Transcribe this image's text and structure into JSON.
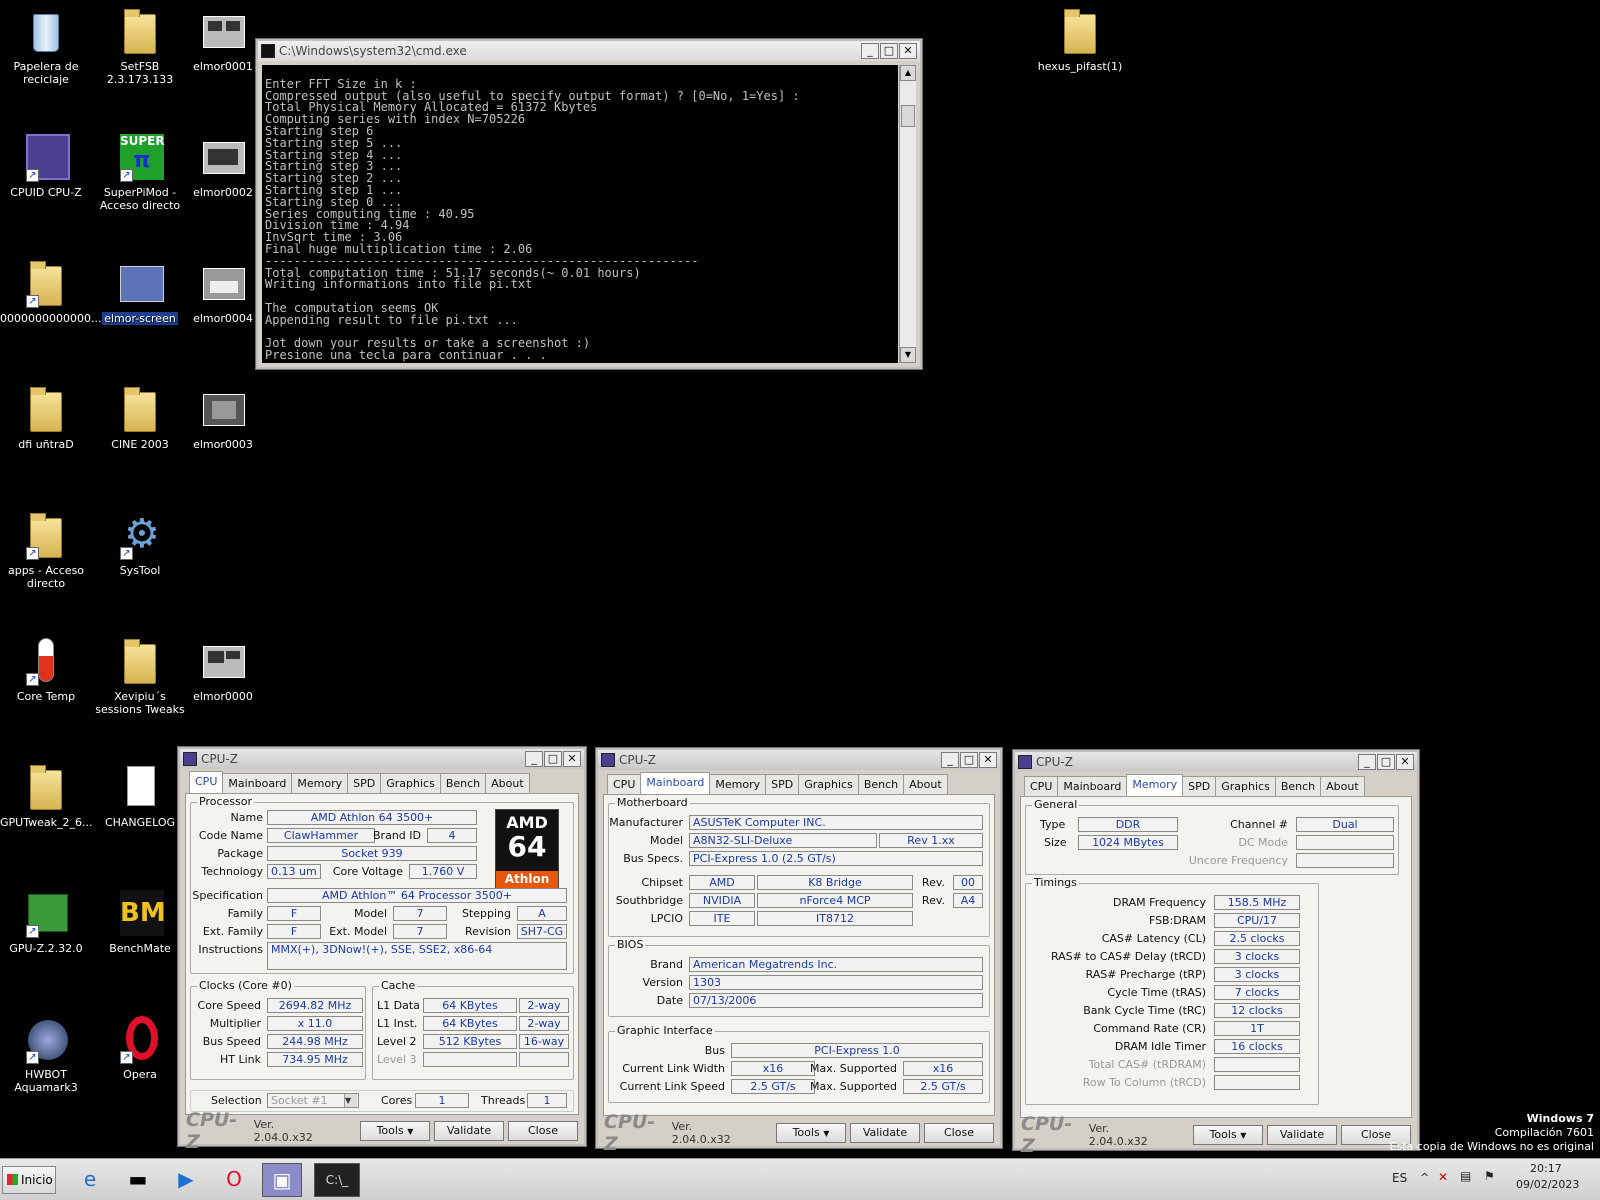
{
  "desktop": {
    "icons": [
      {
        "label": "Papelera de reciclaje",
        "icon": "recycle-bin-icon"
      },
      {
        "label": "SetFSB 2.3.173.133",
        "icon": "folder-icon"
      },
      {
        "label": "elmor0001",
        "icon": "image-thumbnail-icon"
      },
      {
        "label": "CPUID CPU-Z",
        "icon": "cpuz-icon"
      },
      {
        "label": "SuperPiMod - Acceso directo",
        "icon": "superpi-icon"
      },
      {
        "label": "elmor0002",
        "icon": "image-thumbnail-icon"
      },
      {
        "label": "0000000000000...",
        "icon": "folder-icon"
      },
      {
        "label": "elmor-screen",
        "icon": "window-thumbnail-icon"
      },
      {
        "label": "elmor0004",
        "icon": "image-thumbnail-icon"
      },
      {
        "label": "dfi uñtraD",
        "icon": "folder-icon"
      },
      {
        "label": "CINE 2003",
        "icon": "folder-icon"
      },
      {
        "label": "elmor0003",
        "icon": "image-thumbnail-icon"
      },
      {
        "label": "apps - Acceso directo",
        "icon": "folder-icon"
      },
      {
        "label": "SysTool",
        "icon": "gear-icon"
      },
      {
        "label": "Core Temp",
        "icon": "thermometer-icon"
      },
      {
        "label": "Xevipiu´s sessions Tweaks",
        "icon": "folder-icon"
      },
      {
        "label": "elmor0000",
        "icon": "image-thumbnail-icon"
      },
      {
        "label": "GPUTweak_2_6...",
        "icon": "folder-icon"
      },
      {
        "label": "CHANGELOG",
        "icon": "text-file-icon"
      },
      {
        "label": "GPU-Z.2.32.0",
        "icon": "gpuz-icon"
      },
      {
        "label": "BenchMate",
        "icon": "benchmate-icon"
      },
      {
        "label": "HWBOT Aquamark3",
        "icon": "aquamark-icon"
      },
      {
        "label": "Opera",
        "icon": "opera-icon"
      },
      {
        "label": "hexus_pifast(1)",
        "icon": "folder-icon"
      }
    ]
  },
  "cmd": {
    "title": "C:\\Windows\\system32\\cmd.exe",
    "lines": [
      "",
      "Enter FFT Size in k :",
      "Compressed output (also useful to specify output format) ? [0=No, 1=Yes] :",
      "Total Physical Memory Allocated = 61372 Kbytes",
      "Computing series with index N=705226",
      "Starting step 6",
      "Starting step 5 ...",
      "Starting step 4 ...",
      "Starting step 3 ...",
      "Starting step 2 ...",
      "Starting step 1 ...",
      "Starting step 0 ...",
      "Series computing time : 40.95",
      "Division time : 4.94",
      "InvSqrt time : 3.06",
      "Final huge multiplication time : 2.06",
      "------------------------------------------------------------",
      "Total computation time : 51.17 seconds(~ 0.01 hours)",
      "Writing informations into file pi.txt",
      "",
      "The computation seems OK",
      "Appending result to file pi.txt ...",
      "",
      "Jot down your results or take a screenshot :)",
      "Presione una tecla para continuar . . ."
    ]
  },
  "cpuz": {
    "title": "CPU-Z",
    "tabs": [
      "CPU",
      "Mainboard",
      "Memory",
      "SPD",
      "Graphics",
      "Bench",
      "About"
    ],
    "version": "Ver. 2.04.0.x32",
    "logo": "CPU-Z",
    "buttons": {
      "tools": "Tools",
      "validate": "Validate",
      "close": "Close"
    },
    "cpu": {
      "processor_label": "Processor",
      "name_l": "Name",
      "name": "AMD Athlon 64 3500+",
      "codename_l": "Code Name",
      "codename": "ClawHammer",
      "brandid_l": "Brand ID",
      "brandid": "4",
      "package_l": "Package",
      "package": "Socket 939",
      "tech_l": "Technology",
      "tech": "0.13 um",
      "vcore_l": "Core Voltage",
      "vcore": "1.760 V",
      "spec_l": "Specification",
      "spec": "AMD Athlon™ 64 Processor 3500+",
      "family_l": "Family",
      "family": "F",
      "model_l": "Model",
      "model": "7",
      "stepping_l": "Stepping",
      "stepping": "A",
      "extfam_l": "Ext. Family",
      "extfam": "F",
      "extmodel_l": "Ext. Model",
      "extmodel": "7",
      "revision_l": "Revision",
      "revision": "SH7-CG",
      "instr_l": "Instructions",
      "instr": "MMX(+), 3DNow!(+), SSE, SSE2, x86-64",
      "clocks_label": "Clocks (Core #0)",
      "corespeed_l": "Core Speed",
      "corespeed": "2694.82 MHz",
      "mult_l": "Multiplier",
      "mult": "x 11.0",
      "bus_l": "Bus Speed",
      "bus": "244.98 MHz",
      "ht_l": "HT Link",
      "ht": "734.95 MHz",
      "cache_label": "Cache",
      "l1d_l": "L1 Data",
      "l1d": "64 KBytes",
      "l1d_w": "2-way",
      "l1i_l": "L1 Inst.",
      "l1i": "64 KBytes",
      "l1i_w": "2-way",
      "l2_l": "Level 2",
      "l2": "512 KBytes",
      "l2_w": "16-way",
      "l3_l": "Level 3",
      "sel_l": "Selection",
      "sel": "Socket #1",
      "cores_l": "Cores",
      "cores": "1",
      "threads_l": "Threads",
      "threads": "1",
      "logo_t1": "AMD",
      "logo_t2": "64",
      "logo_t3": "Athlon"
    },
    "mb": {
      "mb_label": "Motherboard",
      "manu_l": "Manufacturer",
      "manu": "ASUSTeK Computer INC.",
      "model_l": "Model",
      "model": "A8N32-SLI-Deluxe",
      "rev": "Rev 1.xx",
      "busspec_l": "Bus Specs.",
      "busspec": "PCI-Express 1.0 (2.5 GT/s)",
      "chipset_l": "Chipset",
      "chipset_v": "AMD",
      "chipset_n": "K8 Bridge",
      "rev_l": "Rev.",
      "chipset_r": "00",
      "sb_l": "Southbridge",
      "sb_v": "NVIDIA",
      "sb_n": "nForce4 MCP",
      "sb_r": "A4",
      "lpcio_l": "LPCIO",
      "lpcio_v": "ITE",
      "lpcio_n": "IT8712",
      "bios_label": "BIOS",
      "brand_l": "Brand",
      "brand": "American Megatrends Inc.",
      "version_l": "Version",
      "version": "1303",
      "date_l": "Date",
      "date": "07/13/2006",
      "gi_label": "Graphic Interface",
      "gbus_l": "Bus",
      "gbus": "PCI-Express 1.0",
      "clw_l": "Current Link Width",
      "clw": "x16",
      "maxs_l": "Max. Supported",
      "mlw": "x16",
      "cls_l": "Current Link Speed",
      "cls": "2.5 GT/s",
      "mls": "2.5 GT/s"
    },
    "mem": {
      "gen_label": "General",
      "type_l": "Type",
      "type": "DDR",
      "chan_l": "Channel #",
      "chan": "Dual",
      "size_l": "Size",
      "size": "1024 MBytes",
      "dc_l": "DC Mode",
      "unc_l": "Uncore Frequency",
      "tim_label": "Timings",
      "dram_l": "DRAM Frequency",
      "dram": "158.5 MHz",
      "fsb_l": "FSB:DRAM",
      "fsb": "CPU/17",
      "cl_l": "CAS# Latency (CL)",
      "cl": "2.5 clocks",
      "trcd_l": "RAS# to CAS# Delay (tRCD)",
      "trcd": "3 clocks",
      "trp_l": "RAS# Precharge (tRP)",
      "trp": "3 clocks",
      "tras_l": "Cycle Time (tRAS)",
      "tras": "7 clocks",
      "trc_l": "Bank Cycle Time (tRC)",
      "trc": "12 clocks",
      "cr_l": "Command Rate (CR)",
      "cr": "1T",
      "idle_l": "DRAM Idle Timer",
      "idle": "16 clocks",
      "tcas_l": "Total CAS# (tRDRAM)",
      "rtc_l": "Row To Column (tRCD)"
    }
  },
  "taskbar": {
    "start": "Inicio",
    "lang": "ES",
    "time": "20:17",
    "date": "09/02/2023"
  },
  "watermark": {
    "l1": "Windows 7",
    "l2": "Compilación  7601",
    "l3": "Esta copia de Windows no es original"
  }
}
